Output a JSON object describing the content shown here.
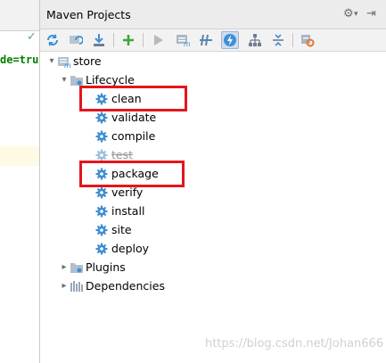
{
  "panel": {
    "title": "Maven Projects",
    "gear_glyph": "⚙",
    "hide_glyph": "⇥",
    "dropdown_glyph": "▾"
  },
  "editor": {
    "code_fragment": "de=tru"
  },
  "toolbar": {
    "buttons": [
      {
        "name": "reimport-icon"
      },
      {
        "name": "generate-sources-icon"
      },
      {
        "name": "download-icon"
      },
      {
        "name": "add-maven-project-icon"
      },
      {
        "name": "run-maven-build-icon"
      },
      {
        "name": "execute-maven-goal-icon"
      },
      {
        "name": "toggle-offline-mode-icon"
      },
      {
        "name": "skip-tests-icon",
        "active": true
      },
      {
        "name": "show-dependencies-icon"
      },
      {
        "name": "collapse-all-icon"
      },
      {
        "name": "maven-settings-icon"
      }
    ]
  },
  "tree": {
    "root": {
      "label": "store"
    },
    "lifecycle": {
      "label": "Lifecycle",
      "goals": [
        {
          "label": "clean",
          "highlighted": true
        },
        {
          "label": "validate"
        },
        {
          "label": "compile"
        },
        {
          "label": "test",
          "disabled": true
        },
        {
          "label": "package",
          "highlighted": true
        },
        {
          "label": "verify"
        },
        {
          "label": "install"
        },
        {
          "label": "site"
        },
        {
          "label": "deploy"
        }
      ]
    },
    "plugins": {
      "label": "Plugins"
    },
    "dependencies": {
      "label": "Dependencies"
    }
  },
  "colors": {
    "highlight_box": "#e3161b",
    "gear": "#3f8fd2"
  },
  "watermark": "https://blog.csdn.net/Johan666"
}
